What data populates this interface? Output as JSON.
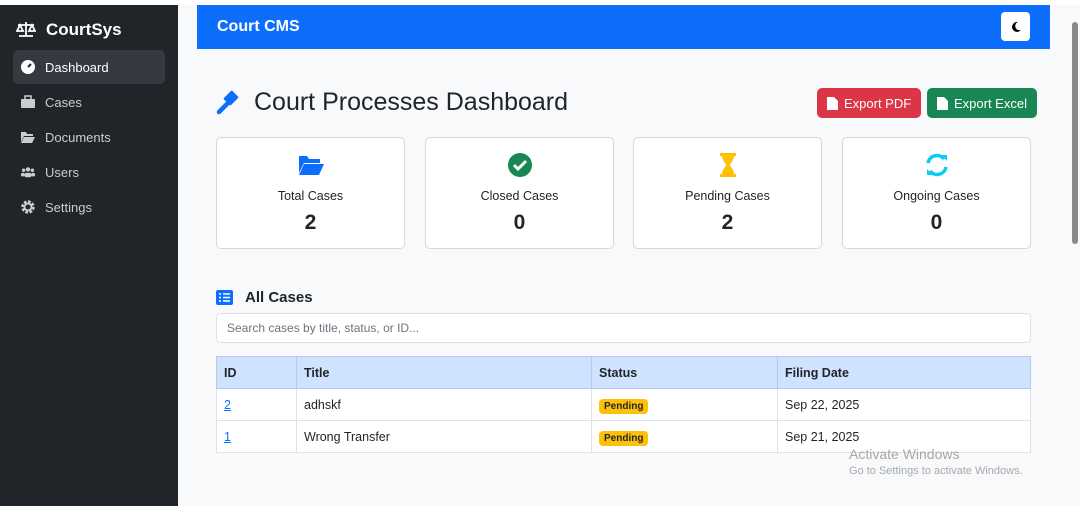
{
  "sidebar": {
    "brand": "CourtSys",
    "items": [
      {
        "label": "Dashboard"
      },
      {
        "label": "Cases"
      },
      {
        "label": "Documents"
      },
      {
        "label": "Users"
      },
      {
        "label": "Settings"
      }
    ]
  },
  "header": {
    "title": "Court CMS"
  },
  "main": {
    "title": "Court Processes Dashboard",
    "export_pdf": "Export PDF",
    "export_excel": "Export Excel",
    "cards": [
      {
        "label": "Total Cases",
        "value": "2"
      },
      {
        "label": "Closed Cases",
        "value": "0"
      },
      {
        "label": "Pending Cases",
        "value": "2"
      },
      {
        "label": "Ongoing Cases",
        "value": "0"
      }
    ],
    "section": "All Cases",
    "search_placeholder": "Search cases by title, status, or ID...",
    "columns": [
      "ID",
      "Title",
      "Status",
      "Filing Date"
    ],
    "rows": [
      {
        "id": "2",
        "title": "adhskf",
        "status": "Pending",
        "date": "Sep 22, 2025"
      },
      {
        "id": "1",
        "title": "Wrong Transfer",
        "status": "Pending",
        "date": "Sep 21, 2025"
      }
    ]
  },
  "watermark": {
    "line1": "Activate Windows",
    "line2": "Go to Settings to activate Windows."
  },
  "colors": {
    "primary": "#0d6efd",
    "danger": "#dc3545",
    "success": "#198754",
    "warning": "#ffc107",
    "info": "#0dcaf0"
  }
}
